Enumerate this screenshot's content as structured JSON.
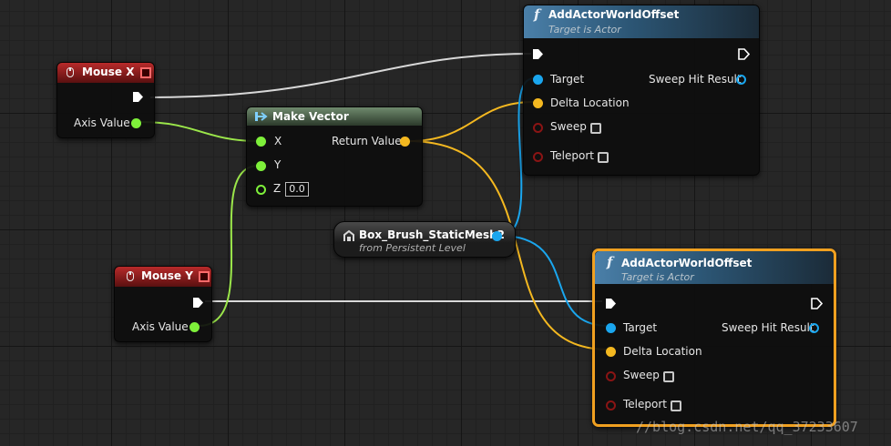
{
  "nodes": {
    "mouse_x": {
      "title": "Mouse X",
      "output_label": "Axis Value"
    },
    "mouse_y": {
      "title": "Mouse Y",
      "output_label": "Axis Value"
    },
    "make_vector": {
      "title": "Make Vector",
      "inputs": [
        "X",
        "Y",
        "Z"
      ],
      "z_value": "0.0",
      "output_label": "Return Value"
    },
    "box_brush": {
      "title": "Box_Brush_StaticMesh2",
      "subtitle": "from Persistent Level"
    },
    "add_offset_1": {
      "title": "AddActorWorldOffset",
      "subtitle": "Target is Actor",
      "function_glyph": "f",
      "inputs": [
        "Target",
        "Delta Location",
        "Sweep",
        "Teleport"
      ],
      "output_label": "Sweep Hit Result"
    },
    "add_offset_2": {
      "title": "AddActorWorldOffset",
      "subtitle": "Target is Actor",
      "function_glyph": "f",
      "inputs": [
        "Target",
        "Delta Location",
        "Sweep",
        "Teleport"
      ],
      "output_label": "Sweep Hit Result",
      "selected": true
    }
  },
  "watermark": "//blog.csdn.net/qq_37233607",
  "colors": {
    "exec": "#ffffff",
    "float": "#7ef03a",
    "vector": "#f4b820",
    "object": "#1aa6ee",
    "bool": "#8a1414",
    "selection": "#f0a020"
  },
  "icons": [
    "mouse-icon",
    "function-icon",
    "object-reference-icon",
    "exec-pin-icon"
  ]
}
